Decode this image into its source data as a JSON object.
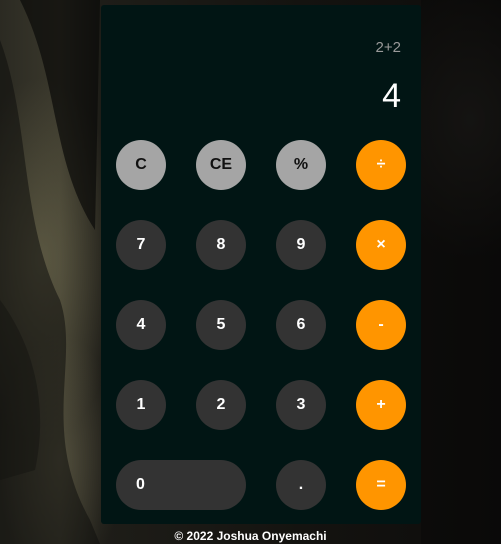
{
  "display": {
    "expression": "2+2",
    "result": "4"
  },
  "keys": {
    "clear": "C",
    "clear_entry": "CE",
    "percent": "%",
    "divide": "÷",
    "seven": "7",
    "eight": "8",
    "nine": "9",
    "multiply": "×",
    "four": "4",
    "five": "5",
    "six": "6",
    "subtract": "-",
    "one": "1",
    "two": "2",
    "three": "3",
    "add": "+",
    "zero": "0",
    "decimal": ".",
    "equals": "="
  },
  "colors": {
    "calculator_bg": "#011514",
    "function_key": "#a5a5a5",
    "number_key": "#333333",
    "operator_key": "#ff9500"
  },
  "footer": {
    "copyright": "© 2022 Joshua Onyemachi"
  }
}
